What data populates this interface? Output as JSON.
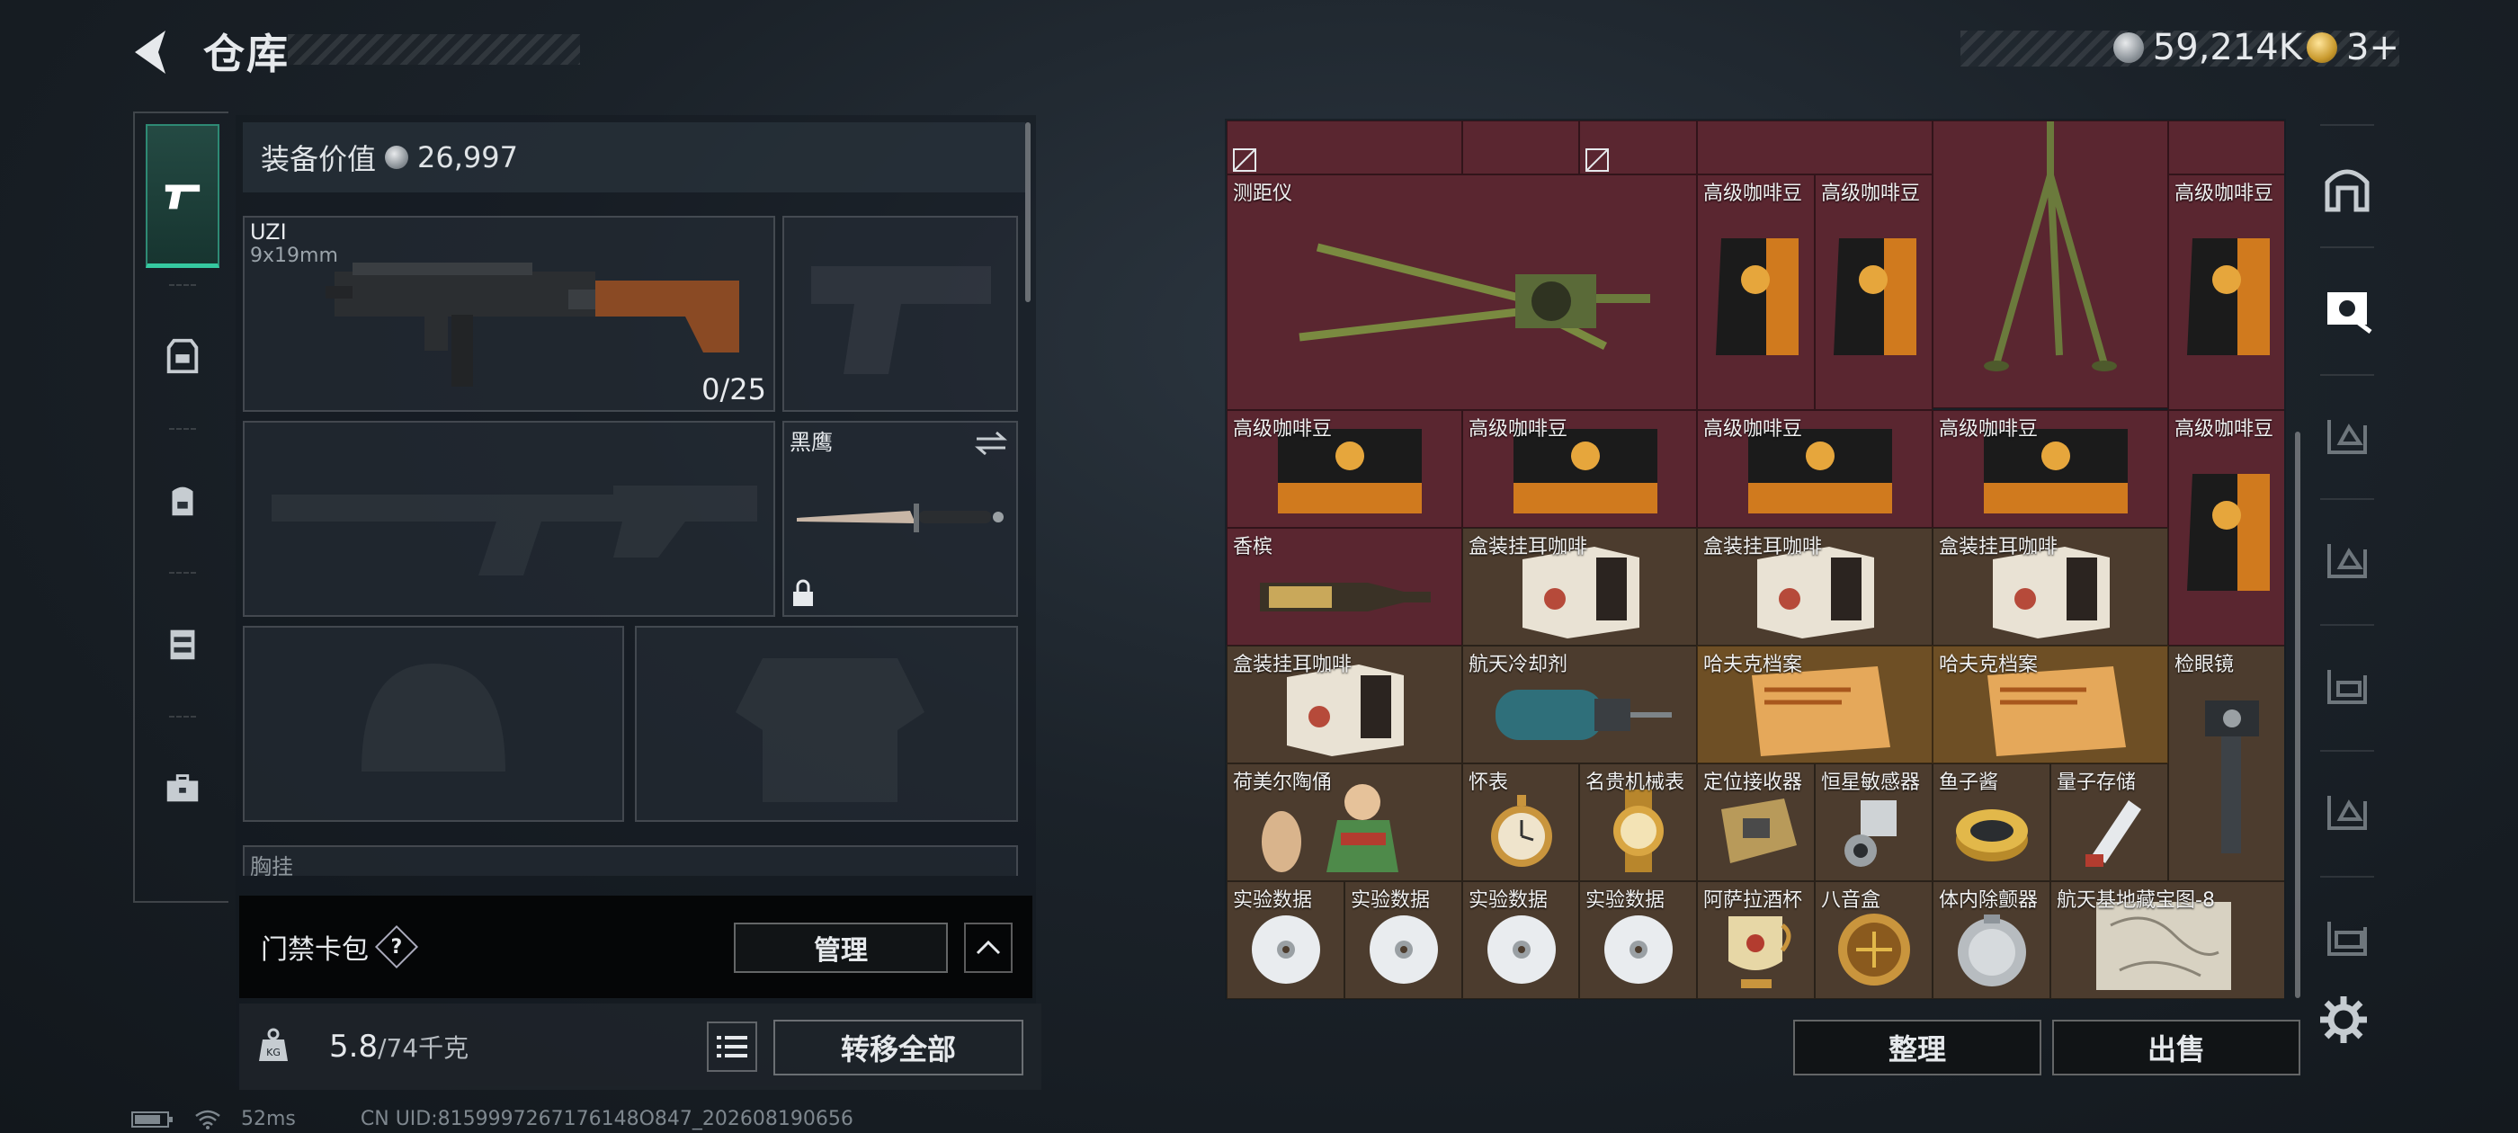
{
  "header": {
    "title": "仓库",
    "money": "59,214K",
    "tickets": "3+"
  },
  "equipment": {
    "value_label": "装备价值",
    "value": "26,997",
    "primary_weapon": {
      "name": "UZI",
      "caliber": "9x19mm",
      "ammo": "0/25"
    },
    "melee": {
      "name": "黑鹰"
    },
    "chest_rig_label": "胸挂",
    "keycard_label": "门禁卡包",
    "help_glyph": "?",
    "manage_label": "管理",
    "weight_current": "5.8",
    "weight_max": "/74千克",
    "transfer_all_label": "转移全部"
  },
  "status": {
    "ping": "52ms",
    "uid": "CN UID:8159997267176148O847_202608190656"
  },
  "storage": {
    "items": [
      {
        "name": "测距仪",
        "color": "red"
      },
      {
        "name": "高级咖啡豆",
        "color": "red"
      },
      {
        "name": "高级咖啡豆",
        "color": "red"
      },
      {
        "name": "高级咖啡豆",
        "color": "red"
      },
      {
        "name": "高级咖啡豆",
        "color": "red"
      },
      {
        "name": "高级咖啡豆",
        "color": "red"
      },
      {
        "name": "高级咖啡豆",
        "color": "red"
      },
      {
        "name": "高级咖啡豆",
        "color": "red"
      },
      {
        "name": "高级咖啡豆",
        "color": "red"
      },
      {
        "name": "香槟",
        "color": "red"
      },
      {
        "name": "盒装挂耳咖啡",
        "color": "brown"
      },
      {
        "name": "盒装挂耳咖啡",
        "color": "brown"
      },
      {
        "name": "盒装挂耳咖啡",
        "color": "brown"
      },
      {
        "name": "盒装挂耳咖啡",
        "color": "brown"
      },
      {
        "name": "航天冷却剂",
        "color": "brown"
      },
      {
        "name": "哈夫克档案",
        "color": "brown"
      },
      {
        "name": "哈夫克档案",
        "color": "brown"
      },
      {
        "name": "检眼镜",
        "color": "brown"
      },
      {
        "name": "荷美尔陶俑",
        "color": "brown"
      },
      {
        "name": "怀表",
        "color": "brown"
      },
      {
        "name": "名贵机械表",
        "color": "brown"
      },
      {
        "name": "定位接收器",
        "color": "brown"
      },
      {
        "name": "恒星敏感器",
        "color": "brown"
      },
      {
        "name": "鱼子酱",
        "color": "brown"
      },
      {
        "name": "量子存储",
        "color": "brown"
      },
      {
        "name": "实验数据",
        "color": "brown"
      },
      {
        "name": "实验数据",
        "color": "brown"
      },
      {
        "name": "实验数据",
        "color": "brown"
      },
      {
        "name": "实验数据",
        "color": "brown"
      },
      {
        "name": "阿萨拉酒杯",
        "color": "brown"
      },
      {
        "name": "八音盒",
        "color": "brown"
      },
      {
        "name": "体内除颤器",
        "color": "brown"
      },
      {
        "name": "航天基地藏宝图-8",
        "color": "brown"
      }
    ],
    "sort_label": "整理",
    "sell_label": "出售"
  },
  "colors": {
    "accent": "#35c9a0",
    "item_red": "#5a2630",
    "item_brown": "#4c3c2e"
  },
  "icons": {
    "left_nav": [
      "pistol-icon",
      "armor-icon",
      "backpack-icon",
      "chest-rig-icon",
      "toolbox-icon"
    ],
    "right_nav": [
      "storage-home-icon",
      "safe-box-icon",
      "shelf-1-icon",
      "shelf-2-icon",
      "shelf-3-icon",
      "shelf-4-icon",
      "shelf-5-icon",
      "settings-icon"
    ]
  }
}
